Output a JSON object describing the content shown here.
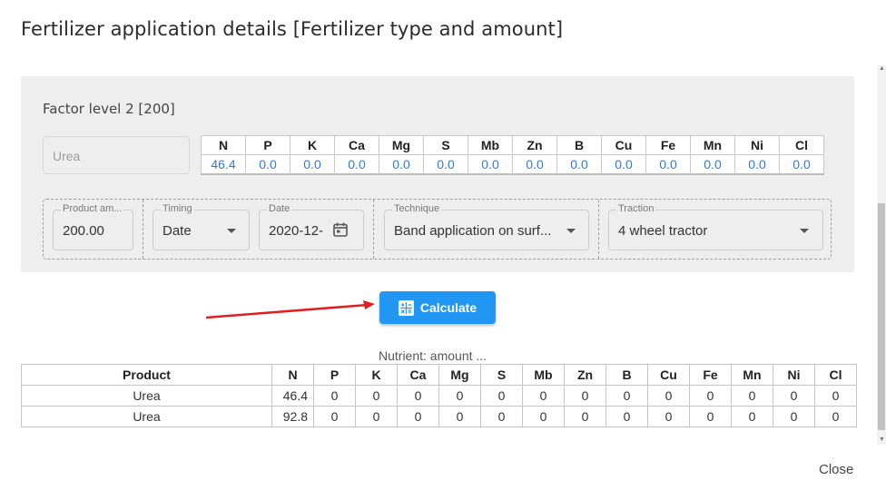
{
  "dialog": {
    "title": "Fertilizer application details [Fertilizer type and amount]",
    "close_label": "Close"
  },
  "factor": {
    "title": "Factor level 2 [200]",
    "product_placeholder": "Urea",
    "nutrients": [
      {
        "name": "N",
        "value": "46.4"
      },
      {
        "name": "P",
        "value": "0.0"
      },
      {
        "name": "K",
        "value": "0.0"
      },
      {
        "name": "Ca",
        "value": "0.0"
      },
      {
        "name": "Mg",
        "value": "0.0"
      },
      {
        "name": "S",
        "value": "0.0"
      },
      {
        "name": "Mb",
        "value": "0.0"
      },
      {
        "name": "Zn",
        "value": "0.0"
      },
      {
        "name": "B",
        "value": "0.0"
      },
      {
        "name": "Cu",
        "value": "0.0"
      },
      {
        "name": "Fe",
        "value": "0.0"
      },
      {
        "name": "Mn",
        "value": "0.0"
      },
      {
        "name": "Ni",
        "value": "0.0"
      },
      {
        "name": "Cl",
        "value": "0.0"
      }
    ],
    "fields": {
      "product_amount": {
        "label": "Product am...",
        "value": "200.00"
      },
      "timing": {
        "label": "Timing",
        "value": "Date"
      },
      "date": {
        "label": "Date",
        "value": "2020-12-"
      },
      "technique": {
        "label": "Technique",
        "value": "Band application on surf..."
      },
      "traction": {
        "label": "Traction",
        "value": "4 wheel tractor"
      }
    }
  },
  "calculate_label": "Calculate",
  "result": {
    "caption": "Nutrient: amount ...",
    "columns": [
      "Product",
      "N",
      "P",
      "K",
      "Ca",
      "Mg",
      "S",
      "Mb",
      "Zn",
      "B",
      "Cu",
      "Fe",
      "Mn",
      "Ni",
      "Cl"
    ],
    "rows": [
      [
        "Urea",
        "46.4",
        "0",
        "0",
        "0",
        "0",
        "0",
        "0",
        "0",
        "0",
        "0",
        "0",
        "0",
        "0",
        "0"
      ],
      [
        "Urea",
        "92.8",
        "0",
        "0",
        "0",
        "0",
        "0",
        "0",
        "0",
        "0",
        "0",
        "0",
        "0",
        "0",
        "0"
      ]
    ]
  },
  "colors": {
    "accent": "#2196f3",
    "value_text": "#2c7be5",
    "arrow": "#e02020"
  },
  "icons": {
    "calculate": "calculator-icon",
    "date": "calendar-icon",
    "dropdown": "caret-down-icon"
  }
}
